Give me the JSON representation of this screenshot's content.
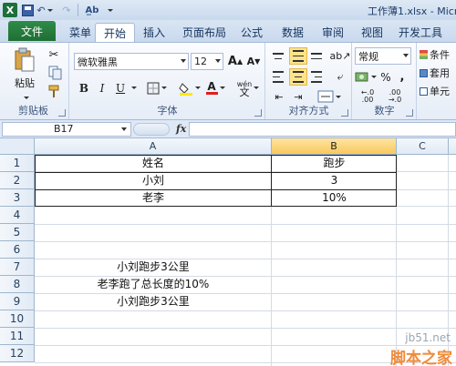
{
  "window": {
    "title": "工作薄1.xlsx - Micro"
  },
  "quick_access": {
    "app_icon": "X"
  },
  "tabs": {
    "file": "文件",
    "items": [
      "菜单",
      "开始",
      "插入",
      "页面布局",
      "公式",
      "数据",
      "审阅",
      "视图",
      "开发工具"
    ],
    "active": "开始"
  },
  "ribbon": {
    "clipboard": {
      "paste_label": "粘贴",
      "group_label": "剪贴板"
    },
    "font": {
      "font_name": "微软雅黑",
      "font_size": "12",
      "grow_label": "A",
      "shrink_label": "A",
      "bold": "B",
      "italic": "I",
      "underline": "U",
      "color_a": "A",
      "phonetic": "wén",
      "group_label": "字体"
    },
    "alignment": {
      "group_label": "对齐方式"
    },
    "number": {
      "format": "常规",
      "percent": "%",
      "comma": ",",
      "inc_decimal": ".00",
      "dec_decimal": ".00",
      "group_label": "数字"
    },
    "styles": {
      "conditional": "条件",
      "table": "套用",
      "cell": "单元"
    }
  },
  "formula_bar": {
    "cell_ref": "B17",
    "fx": "fx",
    "value": ""
  },
  "grid": {
    "columns": [
      "A",
      "B",
      "C"
    ],
    "selected_column": "B",
    "rows": [
      "1",
      "2",
      "3",
      "4",
      "5",
      "6",
      "7",
      "8",
      "9",
      "10",
      "11",
      "12"
    ],
    "cells": {
      "A1": "姓名",
      "B1": "跑步",
      "A2": "小刘",
      "B2": "3",
      "A3": "老李",
      "B3": "10%",
      "A7": "小刘跑步3公里",
      "A8": "老李跑了总长度的10%",
      "A9": "小刘跑步3公里"
    }
  },
  "watermark": {
    "site": "jb51.net",
    "name": "脚本之家"
  },
  "colors": {
    "file_tab": "#1f6e34",
    "selected_column": "#f9c95c",
    "ribbon_bg": "#e6edf7"
  }
}
